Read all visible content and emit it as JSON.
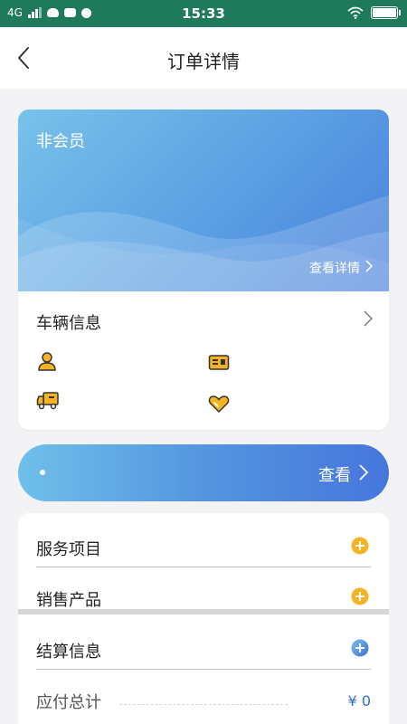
{
  "status_bar": {
    "network": "4G",
    "time": "15:33",
    "battery_level": 1.0
  },
  "nav": {
    "title": "订单详情"
  },
  "member_card": {
    "level": "非会员",
    "detail_link": "查看详情"
  },
  "vehicle": {
    "title": "车辆信息",
    "icons": [
      "person-icon",
      "license-plate-icon",
      "truck-icon",
      "heart-icon"
    ]
  },
  "view_bar": {
    "value": "",
    "label": "查看"
  },
  "sections": [
    {
      "label": "服务项目",
      "icon": "plus-circle-orange-icon"
    },
    {
      "label": "销售产品",
      "icon": "plus-circle-orange-icon"
    },
    {
      "label": "结算信息",
      "icon": "plus-circle-blue-icon"
    }
  ],
  "total": {
    "label": "应付总计",
    "amount": "¥ 0"
  },
  "colors": {
    "status_bar": "#1f7a5c",
    "accent_blue": "#4a7fdc",
    "accent_orange": "#f5b323",
    "amount": "#2f6fd6"
  }
}
